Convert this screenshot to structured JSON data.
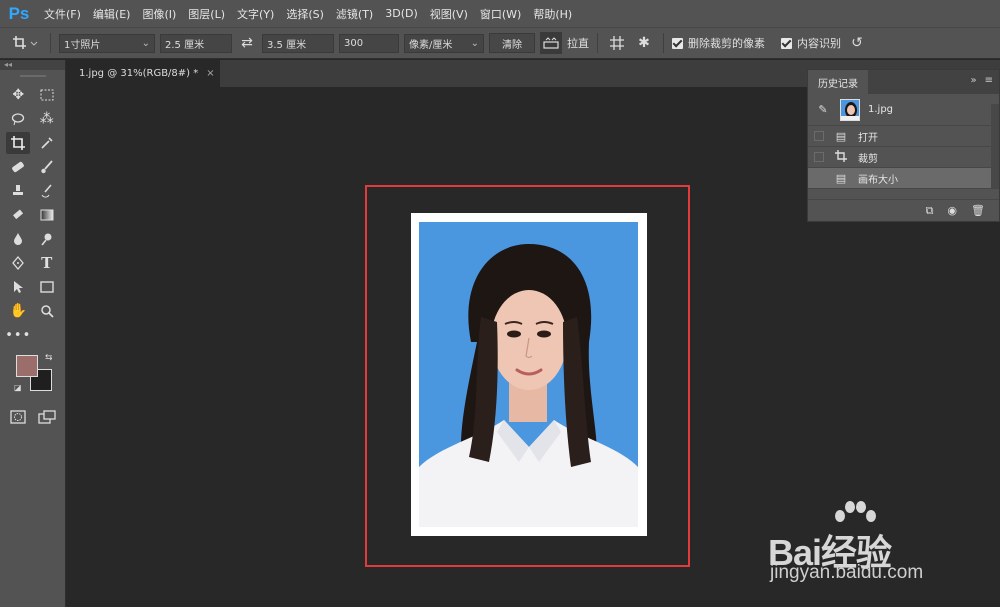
{
  "app": {
    "logo": "Ps"
  },
  "menu": [
    "文件(F)",
    "编辑(E)",
    "图像(I)",
    "图层(L)",
    "文字(Y)",
    "选择(S)",
    "滤镜(T)",
    "3D(D)",
    "视图(V)",
    "窗口(W)",
    "帮助(H)"
  ],
  "options": {
    "preset": "1寸照片",
    "width": "2.5 厘米",
    "height": "3.5 厘米",
    "resolution": "300",
    "unit": "像素/厘米",
    "clear_label": "清除",
    "straighten_label": "拉直",
    "delete_cropped_label": "删除裁剪的像素",
    "content_aware_label": "内容识别"
  },
  "document": {
    "tab_title": "1.jpg @ 31%(RGB/8#) *",
    "close": "×"
  },
  "colors": {
    "foreground": "#9b6e6c",
    "background": "#1f1f1f",
    "highlight": "#e23b3b",
    "photo_bg": "#4a97e0"
  },
  "history": {
    "title": "历史记录",
    "snapshot": "1.jpg",
    "items": [
      {
        "label": "打开",
        "icon": "document-icon"
      },
      {
        "label": "裁剪",
        "icon": "crop-icon"
      },
      {
        "label": "画布大小",
        "icon": "document-icon"
      }
    ]
  },
  "watermark": {
    "main": "Bai经验",
    "sub": "jingyan.baidu.com"
  }
}
